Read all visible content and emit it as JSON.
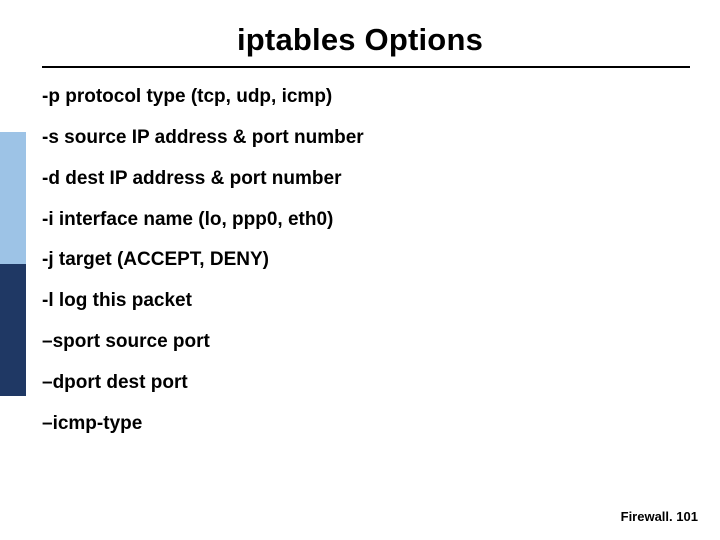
{
  "title": "iptables Options",
  "options": [
    "-p protocol type (tcp, udp, icmp)",
    "-s source IP address & port number",
    "-d dest IP address & port number",
    "-i interface name (lo, ppp0, eth0)",
    "-j target (ACCEPT, DENY)",
    "-l log this packet",
    "–sport source port",
    "–dport dest port",
    "–icmp-type"
  ],
  "footer": {
    "label": "Firewall",
    "separator": ".",
    "page": "101"
  }
}
